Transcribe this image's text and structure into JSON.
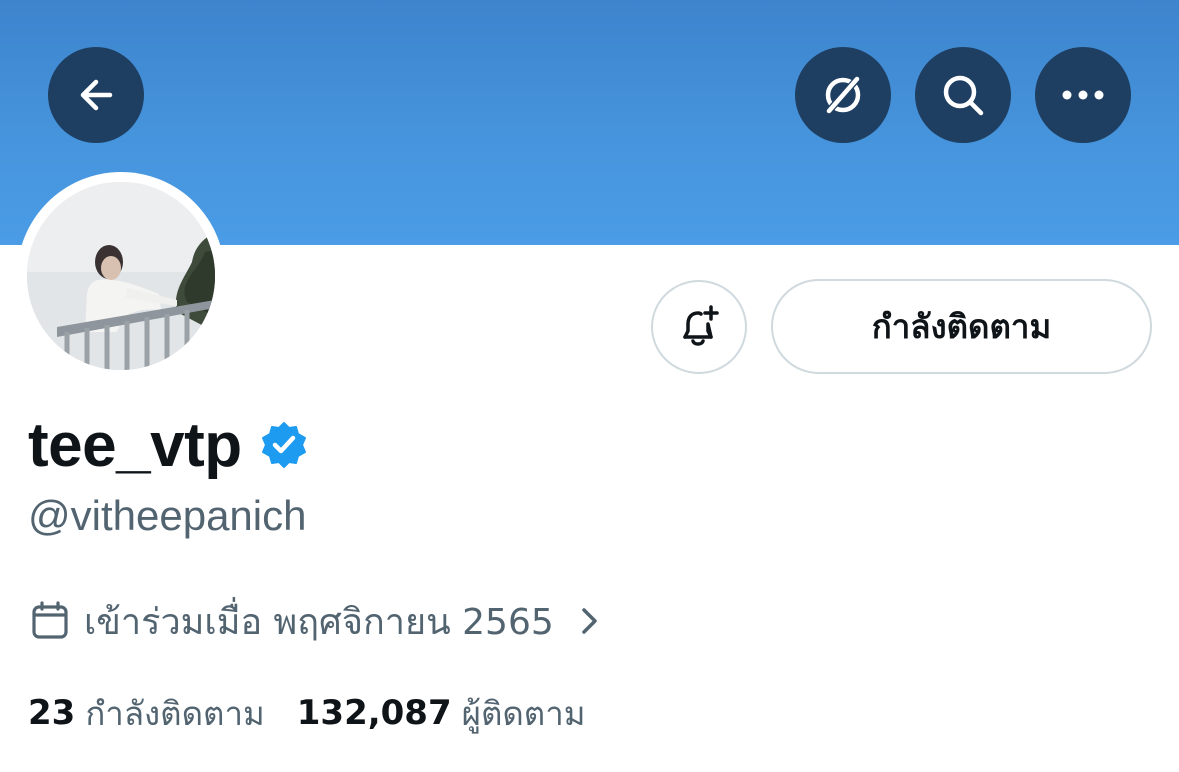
{
  "header": {
    "back_icon": "arrow-left-icon",
    "grok_icon": "grok-icon",
    "search_icon": "search-icon",
    "more_icon": "more-horizontal-icon",
    "banner_color": "#4694dc",
    "button_color": "#1f3f62"
  },
  "profile": {
    "display_name": "tee_vtp",
    "verified_icon": "verified-badge-icon",
    "verified_color": "#1d9bf0",
    "handle": "@vitheepanich",
    "notify_icon": "bell-plus-icon",
    "following_button_label": "กำลังติดตาม",
    "joined_icon": "calendar-icon",
    "joined_text": "เข้าร่วมเมื่อ พฤศจิกายน 2565",
    "joined_chevron_icon": "chevron-right-icon"
  },
  "stats": {
    "following_count": "23",
    "following_label": "กำลังติดตาม",
    "followers_count": "132,087",
    "followers_label": "ผู้ติดตาม"
  }
}
